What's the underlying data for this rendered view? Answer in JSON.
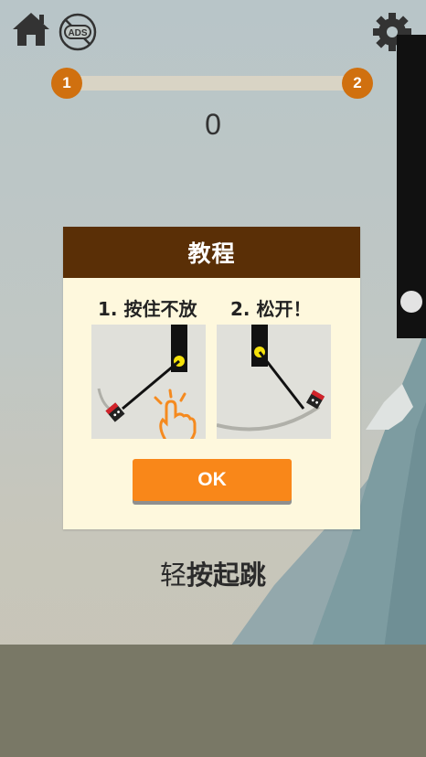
{
  "header": {
    "home_icon": "home-icon",
    "ads_icon": "no-ads-icon",
    "ads_label": "ADS",
    "settings_icon": "gear-icon"
  },
  "progress": {
    "current_level": "1",
    "next_level": "2",
    "fill_fraction": 0,
    "accent_color": "#d0700f"
  },
  "score": "0",
  "tutorial": {
    "title": "教程",
    "step1": "1. 按住不放",
    "step2": "2. 松开！",
    "ok_label": "OK"
  },
  "hint": {
    "prefix": "轻",
    "emphasis": "按起跳"
  },
  "colors": {
    "dialog_header": "#5a2f06",
    "dialog_bg": "#fef8dd",
    "button": "#f98719"
  }
}
